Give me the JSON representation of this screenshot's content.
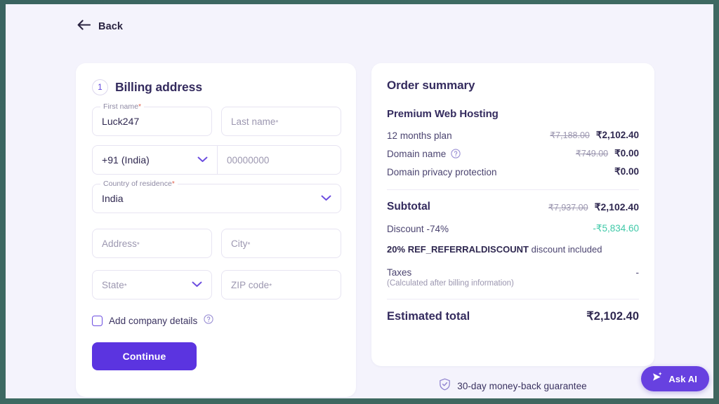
{
  "nav": {
    "back_label": "Back",
    "back_icon": "arrow-left-icon"
  },
  "billing": {
    "step_number": "1",
    "title": "Billing address",
    "fields": {
      "first_name": {
        "label": "First name",
        "required": "*",
        "value": "Luck247"
      },
      "last_name": {
        "label": "Last name",
        "required": "*",
        "placeholder": "Last name",
        "value": ""
      },
      "phone_code": {
        "value": "+91 (India)",
        "icon": "chevron-down-icon"
      },
      "phone_number": {
        "placeholder": "00000000",
        "value": ""
      },
      "country": {
        "label": "Country of residence",
        "required": "*",
        "value": "India",
        "icon": "chevron-down-icon"
      },
      "address": {
        "placeholder": "Address",
        "required": "*",
        "value": ""
      },
      "city": {
        "placeholder": "City",
        "required": "*",
        "value": ""
      },
      "state": {
        "placeholder": "State",
        "required": "*",
        "value": "",
        "icon": "chevron-down-icon"
      },
      "zip": {
        "placeholder": "ZIP code",
        "required": "*",
        "value": ""
      }
    },
    "company_checkbox": {
      "label": "Add company details",
      "checked": false,
      "help_icon": "question-circle-icon"
    },
    "continue_label": "Continue"
  },
  "order": {
    "title": "Order summary",
    "plan_name": "Premium Web Hosting",
    "lines": [
      {
        "label": "12 months plan",
        "old_price": "₹7,188.00",
        "new_price": "₹2,102.40",
        "help_icon": ""
      },
      {
        "label": "Domain name",
        "old_price": "₹749.00",
        "new_price": "₹0.00",
        "help_icon": "question-circle-icon"
      },
      {
        "label": "Domain privacy protection",
        "old_price": "",
        "new_price": "₹0.00",
        "help_icon": ""
      }
    ],
    "subtotal": {
      "label": "Subtotal",
      "old_price": "₹7,937.00",
      "new_price": "₹2,102.40"
    },
    "discount": {
      "label": "Discount -74%",
      "value": "-₹5,834.60"
    },
    "promo": {
      "code_text": "20% REF_REFERRALDISCOUNT",
      "suffix": " discount included"
    },
    "taxes": {
      "label": "Taxes",
      "value": "-",
      "note": "(Calculated after billing information)"
    },
    "total": {
      "label": "Estimated total",
      "value": "₹2,102.40"
    }
  },
  "guarantee": {
    "text": "30-day money-back guarantee",
    "icon": "shield-check-icon"
  },
  "ask_ai": {
    "label": "Ask AI",
    "icon": "sparkle-send-icon"
  },
  "colors": {
    "accent_purple": "#5b34e0",
    "heading_navy": "#342b5e",
    "discount_green": "#3fc9a8",
    "page_bg": "#f4f3fc",
    "frame_teal": "#3c6361"
  }
}
